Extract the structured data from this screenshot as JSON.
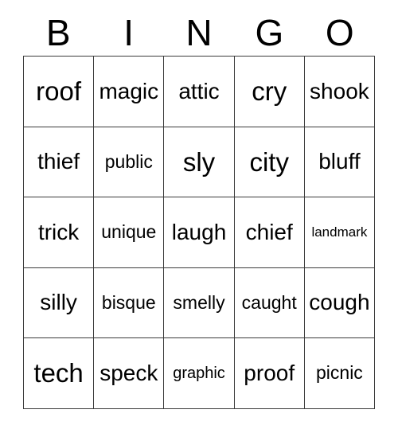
{
  "card": {
    "title": "BINGO",
    "header_letters": [
      "B",
      "I",
      "N",
      "G",
      "O"
    ],
    "colors": {
      "background": "#ffffff",
      "text": "#000000",
      "border": "#3b3b3b"
    },
    "grid": {
      "columns": 5,
      "rows": 5,
      "cells": [
        [
          {
            "word": "roof"
          },
          {
            "word": "magic"
          },
          {
            "word": "attic"
          },
          {
            "word": "cry"
          },
          {
            "word": "shook"
          }
        ],
        [
          {
            "word": "thief"
          },
          {
            "word": "public"
          },
          {
            "word": "sly"
          },
          {
            "word": "city"
          },
          {
            "word": "bluff"
          }
        ],
        [
          {
            "word": "trick"
          },
          {
            "word": "unique"
          },
          {
            "word": "laugh"
          },
          {
            "word": "chief"
          },
          {
            "word": "landmark"
          }
        ],
        [
          {
            "word": "silly"
          },
          {
            "word": "bisque"
          },
          {
            "word": "smelly"
          },
          {
            "word": "caught"
          },
          {
            "word": "cough"
          }
        ],
        [
          {
            "word": "tech"
          },
          {
            "word": "speck"
          },
          {
            "word": "graphic"
          },
          {
            "word": "proof"
          },
          {
            "word": "picnic"
          }
        ]
      ]
    }
  }
}
